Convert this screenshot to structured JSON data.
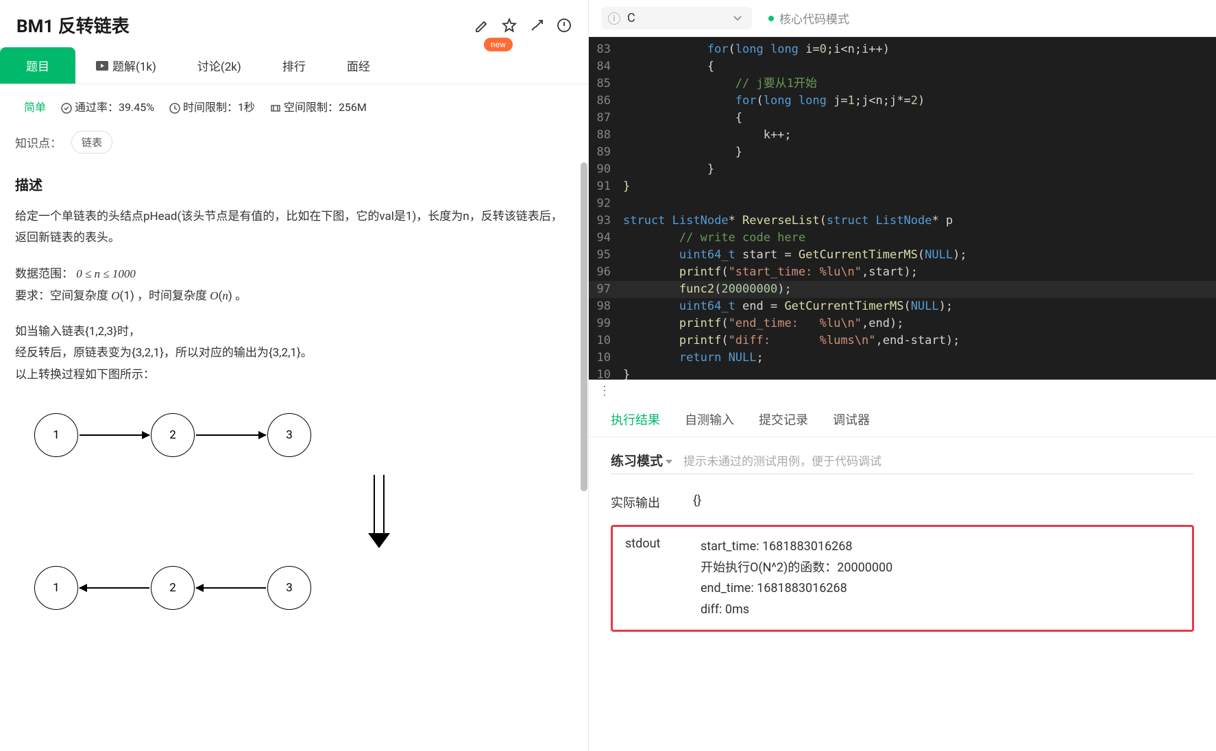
{
  "title": "BM1  反转链表",
  "tabs": [
    "题目",
    "题解(1k)",
    "讨论(2k)",
    "排行",
    "面经"
  ],
  "newBadge": "new",
  "difficulty": "简单",
  "passRate": "通过率：39.45%",
  "timeLimit": "时间限制：1秒",
  "spaceLimit": "空间限制：256M",
  "tagsLabel": "知识点：",
  "tags": [
    "链表"
  ],
  "sectionTitle": "描述",
  "p1": "给定一个单链表的头结点pHead(该头节点是有值的，比如在下图，它的val是1)，长度为n，反转该链表后，返回新链表的表头。",
  "p2a": "数据范围： ",
  "p2math": "0 ≤ n ≤ 1000",
  "p3": "要求：空间复杂度 O(1) ，时间复杂度 O(n) 。",
  "p4": "如当输入链表{1,2,3}时，",
  "p5": "经反转后，原链表变为{3,2,1}，所以对应的输出为{3,2,1}。",
  "p6": "以上转换过程如下图所示：",
  "nodes": [
    "1",
    "2",
    "3"
  ],
  "lang": "C",
  "modeLabel": "核心代码模式",
  "code": [
    {
      "n": "83",
      "indent": 3,
      "segs": [
        {
          "t": "for",
          "c": "kw"
        },
        {
          "t": "("
        },
        {
          "t": "long long",
          "c": "ty"
        },
        {
          "t": " i="
        },
        {
          "t": "0",
          "c": "num"
        },
        {
          "t": ";i<n;i++)"
        }
      ]
    },
    {
      "n": "84",
      "indent": 3,
      "segs": [
        {
          "t": "{"
        }
      ]
    },
    {
      "n": "85",
      "indent": 4,
      "segs": [
        {
          "t": "// j要从1开始",
          "c": "cm"
        }
      ]
    },
    {
      "n": "86",
      "indent": 4,
      "segs": [
        {
          "t": "for",
          "c": "kw"
        },
        {
          "t": "("
        },
        {
          "t": "long long",
          "c": "ty"
        },
        {
          "t": " j="
        },
        {
          "t": "1",
          "c": "num"
        },
        {
          "t": ";j<n;j*="
        },
        {
          "t": "2",
          "c": "num"
        },
        {
          "t": ")"
        }
      ]
    },
    {
      "n": "87",
      "indent": 4,
      "segs": [
        {
          "t": "{"
        }
      ]
    },
    {
      "n": "88",
      "indent": 5,
      "segs": [
        {
          "t": "k++;"
        }
      ]
    },
    {
      "n": "89",
      "indent": 4,
      "segs": [
        {
          "t": "}"
        }
      ]
    },
    {
      "n": "90",
      "indent": 3,
      "segs": [
        {
          "t": "}"
        }
      ]
    },
    {
      "n": "91",
      "indent": 0,
      "segs": [
        {
          "t": "}",
          "c": "fn"
        }
      ]
    },
    {
      "n": "92",
      "indent": 0,
      "segs": []
    },
    {
      "n": "93",
      "indent": 0,
      "segs": [
        {
          "t": "struct",
          "c": "kw"
        },
        {
          "t": " "
        },
        {
          "t": "ListNode",
          "c": "ty"
        },
        {
          "t": "* "
        },
        {
          "t": "ReverseList",
          "c": "fn"
        },
        {
          "t": "("
        },
        {
          "t": "struct",
          "c": "kw"
        },
        {
          "t": " "
        },
        {
          "t": "ListNode",
          "c": "ty"
        },
        {
          "t": "* p"
        }
      ]
    },
    {
      "n": "94",
      "indent": 2,
      "segs": [
        {
          "t": "// write code here",
          "c": "cm"
        }
      ]
    },
    {
      "n": "95",
      "indent": 2,
      "segs": [
        {
          "t": "uint64_t",
          "c": "ty"
        },
        {
          "t": " start = "
        },
        {
          "t": "GetCurrentTimerMS",
          "c": "fn"
        },
        {
          "t": "("
        },
        {
          "t": "NULL",
          "c": "kw"
        },
        {
          "t": ");"
        }
      ]
    },
    {
      "n": "96",
      "indent": 2,
      "segs": [
        {
          "t": "printf",
          "c": "fn"
        },
        {
          "t": "("
        },
        {
          "t": "\"start_time: %lu\\n\"",
          "c": "str"
        },
        {
          "t": ",start);"
        }
      ]
    },
    {
      "n": "97",
      "indent": 2,
      "hl": true,
      "segs": [
        {
          "t": "func2",
          "c": "fn"
        },
        {
          "t": "("
        },
        {
          "t": "20000000",
          "c": "num"
        },
        {
          "t": ");"
        }
      ]
    },
    {
      "n": "98",
      "indent": 2,
      "segs": [
        {
          "t": "uint64_t",
          "c": "ty"
        },
        {
          "t": " end = "
        },
        {
          "t": "GetCurrentTimerMS",
          "c": "fn"
        },
        {
          "t": "("
        },
        {
          "t": "NULL",
          "c": "kw"
        },
        {
          "t": ");"
        }
      ]
    },
    {
      "n": "99",
      "indent": 2,
      "segs": [
        {
          "t": "printf",
          "c": "fn"
        },
        {
          "t": "("
        },
        {
          "t": "\"end_time:   %lu\\n\"",
          "c": "str"
        },
        {
          "t": ",end);"
        }
      ]
    },
    {
      "n": "10",
      "indent": 2,
      "segs": [
        {
          "t": "printf",
          "c": "fn"
        },
        {
          "t": "("
        },
        {
          "t": "\"diff:       %lums\\n\"",
          "c": "str"
        },
        {
          "t": ",end-start);"
        }
      ]
    },
    {
      "n": "10",
      "indent": 2,
      "segs": [
        {
          "t": "return",
          "c": "kw"
        },
        {
          "t": " "
        },
        {
          "t": "NULL",
          "c": "kw"
        },
        {
          "t": ";"
        }
      ]
    },
    {
      "n": "10",
      "indent": 0,
      "segs": [
        {
          "t": "}"
        }
      ]
    }
  ],
  "resultTabs": [
    "执行结果",
    "自测输入",
    "提交记录",
    "调试器"
  ],
  "practiceMode": "练习模式",
  "practiceDesc": "提示未通过的测试用例，便于代码调试",
  "actualOutLabel": "实际输出",
  "actualOut": "{}",
  "stdoutLabel": "stdout",
  "stdout": [
    "start_time: 1681883016268",
    "开始执行O(N^2)的函数：20000000",
    "end_time:    1681883016268",
    "diff:            0ms"
  ]
}
